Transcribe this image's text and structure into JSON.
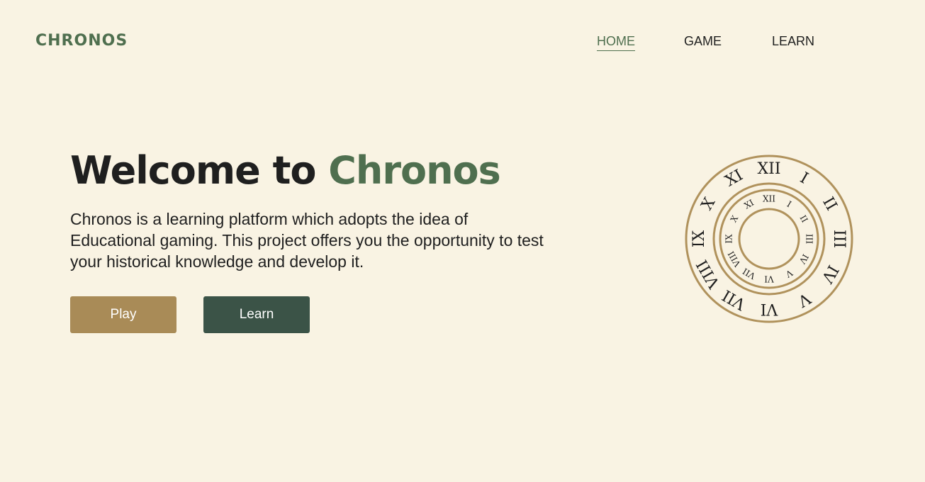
{
  "logo": {
    "text": "CHRONOS"
  },
  "nav": {
    "home": "HOME",
    "game": "GAME",
    "learn": "LEARN"
  },
  "hero": {
    "title_prefix": "Welcome to ",
    "title_accent": "Chronos",
    "description": "Chronos is a learning platform which adopts the idea of Educational gaming. This project offers you the opportunity to test your historical knowledge and develop it."
  },
  "buttons": {
    "play": "Play",
    "learn": "Learn"
  },
  "clock": {
    "numerals": [
      "XII",
      "I",
      "II",
      "III",
      "IV",
      "V",
      "VI",
      "VII",
      "VIII",
      "IX",
      "X",
      "XI"
    ]
  },
  "colors": {
    "background": "#f9f3e3",
    "accent_green": "#4f6f4f",
    "play_button": "#a98b57",
    "learn_button": "#3b5347",
    "clock_ring": "#b0925c"
  }
}
